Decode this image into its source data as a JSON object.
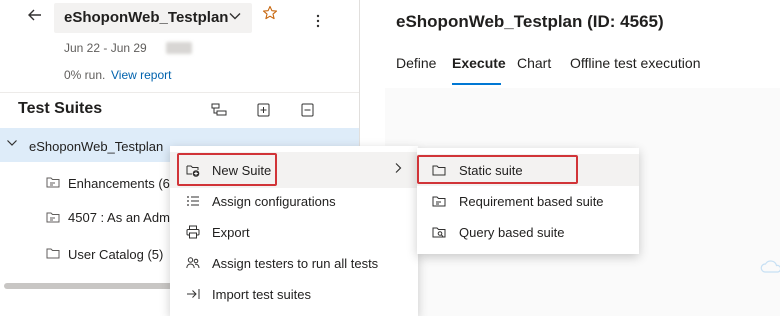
{
  "header": {
    "plan_name": "eShoponWeb_Testplan",
    "date_range": "Jun 22 - Jun 29",
    "run_status": "0% run.",
    "report_link": "View report"
  },
  "suites": {
    "title": "Test Suites",
    "root": "eShoponWeb_Testplan",
    "children": [
      {
        "label": "Enhancements (6)"
      },
      {
        "label": "4507 : As an Admi"
      },
      {
        "label": "User Catalog (5)"
      }
    ]
  },
  "main": {
    "title": "eShoponWeb_Testplan (ID: 4565)",
    "tabs": [
      {
        "label": "Define"
      },
      {
        "label": "Execute"
      },
      {
        "label": "Chart"
      },
      {
        "label": "Offline test execution"
      }
    ],
    "active_tab": "Execute"
  },
  "context_menu": {
    "items": [
      {
        "label": "New Suite",
        "icon": "new-suite-icon"
      },
      {
        "label": "Assign configurations",
        "icon": "list-settings-icon"
      },
      {
        "label": "Export",
        "icon": "print-icon"
      },
      {
        "label": "Assign testers to run all tests",
        "icon": "people-icon"
      },
      {
        "label": "Import test suites",
        "icon": "import-icon"
      }
    ]
  },
  "submenu": {
    "items": [
      {
        "label": "Static suite",
        "icon": "folder-icon"
      },
      {
        "label": "Requirement based suite",
        "icon": "requirement-folder-icon"
      },
      {
        "label": "Query based suite",
        "icon": "query-folder-icon"
      }
    ]
  },
  "colors": {
    "accent": "#0078d4",
    "selected_row": "#deecf9",
    "highlight_box": "#d13438",
    "star": "#c7670f"
  }
}
